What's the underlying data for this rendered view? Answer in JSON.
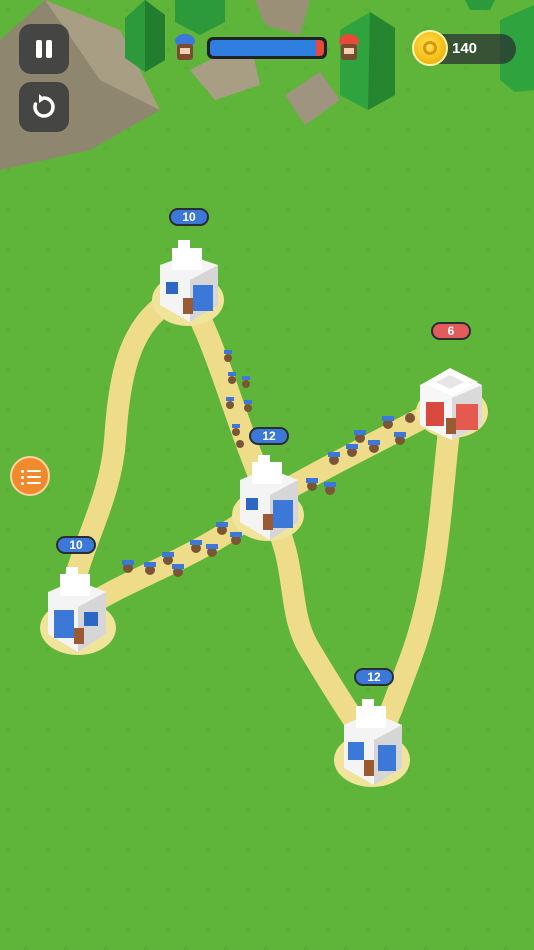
{
  "hud": {
    "pause_icon": "pause-icon",
    "restart_icon": "restart-icon",
    "player_icon": "blue-soldier-icon",
    "enemy_icon": "red-soldier-icon",
    "territory_balance": 0.93,
    "coins": "140",
    "coin_icon": "coin-icon"
  },
  "towers": [
    {
      "owner": "blue",
      "troops": "10"
    },
    {
      "owner": "red",
      "troops": "6"
    },
    {
      "owner": "blue",
      "troops": "12"
    },
    {
      "owner": "blue",
      "troops": "10"
    },
    {
      "owner": "blue",
      "troops": "12"
    }
  ],
  "menu_icon": "list-menu-icon",
  "colors": {
    "grass": "#5fb43a",
    "path": "#eedc8a",
    "player": "#3b78d8",
    "enemy": "#e35b5b",
    "coin": "#f7c21a"
  }
}
